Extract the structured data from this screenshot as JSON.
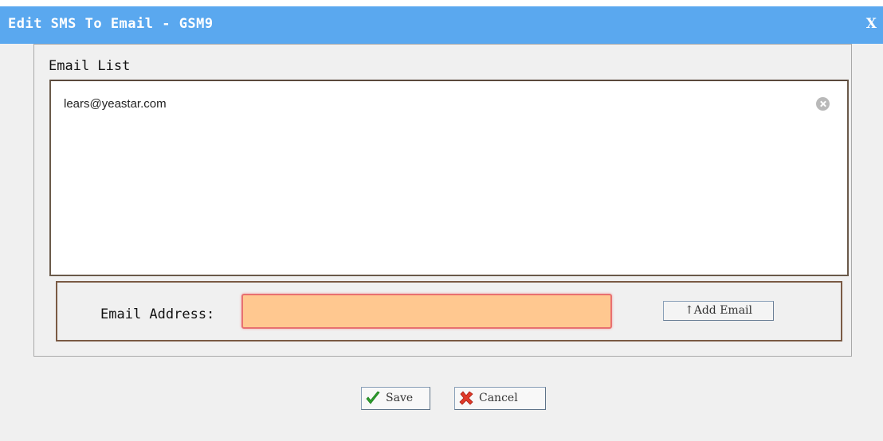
{
  "dialog": {
    "title": "Edit SMS To Email - GSM9",
    "close_label": "X"
  },
  "email_list": {
    "label": "Email List",
    "items": [
      {
        "email": "lears@yeastar.com",
        "remove_icon": "remove-circle-icon"
      }
    ]
  },
  "address_form": {
    "label": "Email Address:",
    "input_value": "",
    "add_button_label": "↑Add Email"
  },
  "actions": {
    "save_label": "Save",
    "save_icon": "green-check-icon",
    "cancel_label": "Cancel",
    "cancel_icon": "red-x-icon"
  },
  "colors": {
    "titlebar": "#5aa8ef",
    "input_bg": "#ffc890",
    "input_border": "#e87070"
  }
}
